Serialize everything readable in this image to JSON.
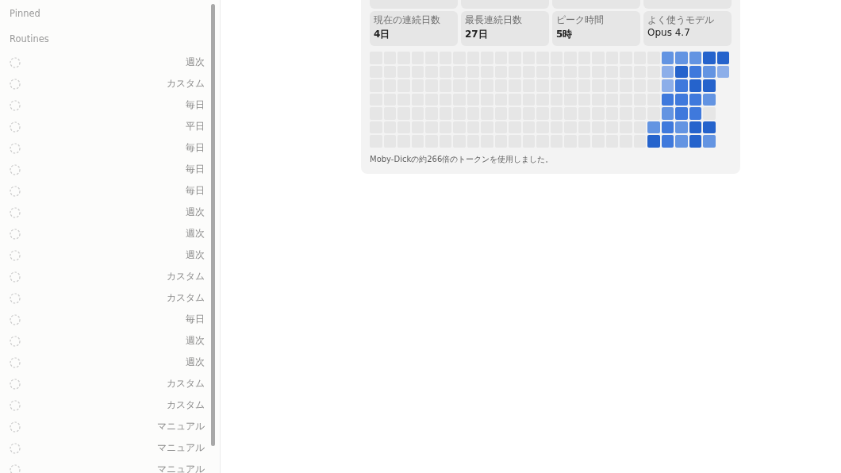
{
  "sidebar": {
    "sections": [
      {
        "title": "Pinned"
      },
      {
        "title": "Routines"
      }
    ],
    "routines": [
      {
        "schedule": "週次"
      },
      {
        "schedule": "カスタム"
      },
      {
        "schedule": "毎日"
      },
      {
        "schedule": "平日"
      },
      {
        "schedule": "毎日"
      },
      {
        "schedule": "毎日"
      },
      {
        "schedule": "毎日"
      },
      {
        "schedule": "週次"
      },
      {
        "schedule": "週次"
      },
      {
        "schedule": "週次"
      },
      {
        "schedule": "カスタム"
      },
      {
        "schedule": "カスタム"
      },
      {
        "schedule": "毎日"
      },
      {
        "schedule": "週次"
      },
      {
        "schedule": "週次"
      },
      {
        "schedule": "カスタム"
      },
      {
        "schedule": "カスタム"
      },
      {
        "schedule": "マニュアル"
      },
      {
        "schedule": "マニュアル"
      },
      {
        "schedule": "マニュアル"
      }
    ]
  },
  "stats": [
    {
      "label": "現在の連続日数",
      "value": "4日",
      "kind": "count"
    },
    {
      "label": "最長連続日数",
      "value": "27日",
      "kind": "count"
    },
    {
      "label": "ピーク時間",
      "value": "5時",
      "kind": "count"
    },
    {
      "label": "よく使うモデル",
      "value": "Opus 4.7",
      "kind": "name"
    }
  ],
  "activity": {
    "rows": [
      [
        {
          "color": "#e6e6e6"
        },
        {
          "color": "#e6e6e6"
        },
        {
          "color": "#e6e6e6"
        },
        {
          "color": "#e6e6e6"
        },
        {
          "color": "#e6e6e6"
        },
        {
          "color": "#e6e6e6"
        },
        {
          "color": "#e6e6e6"
        },
        {
          "color": "#e6e6e6"
        },
        {
          "color": "#e6e6e6"
        },
        {
          "color": "#e6e6e6"
        },
        {
          "color": "#e6e6e6"
        },
        {
          "color": "#e6e6e6"
        },
        {
          "color": "#e6e6e6"
        },
        {
          "color": "#e6e6e6"
        },
        {
          "color": "#e6e6e6"
        },
        {
          "color": "#e6e6e6"
        },
        {
          "color": "#e6e6e6"
        },
        {
          "color": "#e6e6e6"
        },
        {
          "color": "#e6e6e6"
        },
        {
          "color": "#e6e6e6"
        },
        {
          "color": "#e6e6e6"
        },
        {
          "color": "#6394e2"
        },
        {
          "color": "#6394e2"
        },
        {
          "color": "#6394e2"
        },
        {
          "color": "#2563cc"
        },
        {
          "color": "#2563cc"
        }
      ],
      [
        {
          "color": "#e6e6e6"
        },
        {
          "color": "#e6e6e6"
        },
        {
          "color": "#e6e6e6"
        },
        {
          "color": "#e6e6e6"
        },
        {
          "color": "#e6e6e6"
        },
        {
          "color": "#e6e6e6"
        },
        {
          "color": "#e6e6e6"
        },
        {
          "color": "#e6e6e6"
        },
        {
          "color": "#e6e6e6"
        },
        {
          "color": "#e6e6e6"
        },
        {
          "color": "#e6e6e6"
        },
        {
          "color": "#e6e6e6"
        },
        {
          "color": "#e6e6e6"
        },
        {
          "color": "#e6e6e6"
        },
        {
          "color": "#e6e6e6"
        },
        {
          "color": "#e6e6e6"
        },
        {
          "color": "#e6e6e6"
        },
        {
          "color": "#e6e6e6"
        },
        {
          "color": "#e6e6e6"
        },
        {
          "color": "#e6e6e6"
        },
        {
          "color": "#e6e6e6"
        },
        {
          "color": "#8caee9"
        },
        {
          "color": "#2563cc"
        },
        {
          "color": "#3f79dc"
        },
        {
          "color": "#6394e2"
        },
        {
          "color": "#8caee9"
        }
      ],
      [
        {
          "color": "#e6e6e6"
        },
        {
          "color": "#e6e6e6"
        },
        {
          "color": "#e6e6e6"
        },
        {
          "color": "#e6e6e6"
        },
        {
          "color": "#e6e6e6"
        },
        {
          "color": "#e6e6e6"
        },
        {
          "color": "#e6e6e6"
        },
        {
          "color": "#e6e6e6"
        },
        {
          "color": "#e6e6e6"
        },
        {
          "color": "#e6e6e6"
        },
        {
          "color": "#e6e6e6"
        },
        {
          "color": "#e6e6e6"
        },
        {
          "color": "#e6e6e6"
        },
        {
          "color": "#e6e6e6"
        },
        {
          "color": "#e6e6e6"
        },
        {
          "color": "#e6e6e6"
        },
        {
          "color": "#e6e6e6"
        },
        {
          "color": "#e6e6e6"
        },
        {
          "color": "#e6e6e6"
        },
        {
          "color": "#e6e6e6"
        },
        {
          "color": "#e6e6e6"
        },
        {
          "color": "#8caee9"
        },
        {
          "color": "#3f79dc"
        },
        {
          "color": "#2563cc"
        },
        {
          "color": "#2563cc"
        }
      ],
      [
        {
          "color": "#e6e6e6"
        },
        {
          "color": "#e6e6e6"
        },
        {
          "color": "#e6e6e6"
        },
        {
          "color": "#e6e6e6"
        },
        {
          "color": "#e6e6e6"
        },
        {
          "color": "#e6e6e6"
        },
        {
          "color": "#e6e6e6"
        },
        {
          "color": "#e6e6e6"
        },
        {
          "color": "#e6e6e6"
        },
        {
          "color": "#e6e6e6"
        },
        {
          "color": "#e6e6e6"
        },
        {
          "color": "#e6e6e6"
        },
        {
          "color": "#e6e6e6"
        },
        {
          "color": "#e6e6e6"
        },
        {
          "color": "#e6e6e6"
        },
        {
          "color": "#e6e6e6"
        },
        {
          "color": "#e6e6e6"
        },
        {
          "color": "#e6e6e6"
        },
        {
          "color": "#e6e6e6"
        },
        {
          "color": "#e6e6e6"
        },
        {
          "color": "#e6e6e6"
        },
        {
          "color": "#3f79dc"
        },
        {
          "color": "#3f79dc"
        },
        {
          "color": "#3f79dc"
        },
        {
          "color": "#6394e2"
        }
      ],
      [
        {
          "color": "#e6e6e6"
        },
        {
          "color": "#e6e6e6"
        },
        {
          "color": "#e6e6e6"
        },
        {
          "color": "#e6e6e6"
        },
        {
          "color": "#e6e6e6"
        },
        {
          "color": "#e6e6e6"
        },
        {
          "color": "#e6e6e6"
        },
        {
          "color": "#e6e6e6"
        },
        {
          "color": "#e6e6e6"
        },
        {
          "color": "#e6e6e6"
        },
        {
          "color": "#e6e6e6"
        },
        {
          "color": "#e6e6e6"
        },
        {
          "color": "#e6e6e6"
        },
        {
          "color": "#e6e6e6"
        },
        {
          "color": "#e6e6e6"
        },
        {
          "color": "#e6e6e6"
        },
        {
          "color": "#e6e6e6"
        },
        {
          "color": "#e6e6e6"
        },
        {
          "color": "#e6e6e6"
        },
        {
          "color": "#e6e6e6"
        },
        {
          "color": "#e6e6e6"
        },
        {
          "color": "#6394e2"
        },
        {
          "color": "#3f79dc"
        },
        {
          "color": "#3f79dc"
        },
        {
          "color": "#e6e6e6"
        }
      ],
      [
        {
          "color": "#e6e6e6"
        },
        {
          "color": "#e6e6e6"
        },
        {
          "color": "#e6e6e6"
        },
        {
          "color": "#e6e6e6"
        },
        {
          "color": "#e6e6e6"
        },
        {
          "color": "#e6e6e6"
        },
        {
          "color": "#e6e6e6"
        },
        {
          "color": "#e6e6e6"
        },
        {
          "color": "#e6e6e6"
        },
        {
          "color": "#e6e6e6"
        },
        {
          "color": "#e6e6e6"
        },
        {
          "color": "#e6e6e6"
        },
        {
          "color": "#e6e6e6"
        },
        {
          "color": "#e6e6e6"
        },
        {
          "color": "#e6e6e6"
        },
        {
          "color": "#e6e6e6"
        },
        {
          "color": "#e6e6e6"
        },
        {
          "color": "#e6e6e6"
        },
        {
          "color": "#e6e6e6"
        },
        {
          "color": "#e6e6e6"
        },
        {
          "color": "#6394e2"
        },
        {
          "color": "#3f79dc"
        },
        {
          "color": "#6394e2"
        },
        {
          "color": "#2563cc"
        },
        {
          "color": "#2563cc"
        }
      ],
      [
        {
          "color": "#e6e6e6"
        },
        {
          "color": "#e6e6e6"
        },
        {
          "color": "#e6e6e6"
        },
        {
          "color": "#e6e6e6"
        },
        {
          "color": "#e6e6e6"
        },
        {
          "color": "#e6e6e6"
        },
        {
          "color": "#e6e6e6"
        },
        {
          "color": "#e6e6e6"
        },
        {
          "color": "#e6e6e6"
        },
        {
          "color": "#e6e6e6"
        },
        {
          "color": "#e6e6e6"
        },
        {
          "color": "#e6e6e6"
        },
        {
          "color": "#e6e6e6"
        },
        {
          "color": "#e6e6e6"
        },
        {
          "color": "#e6e6e6"
        },
        {
          "color": "#e6e6e6"
        },
        {
          "color": "#e6e6e6"
        },
        {
          "color": "#e6e6e6"
        },
        {
          "color": "#e6e6e6"
        },
        {
          "color": "#e6e6e6"
        },
        {
          "color": "#2563cc"
        },
        {
          "color": "#3f79dc"
        },
        {
          "color": "#6394e2"
        },
        {
          "color": "#2563cc"
        },
        {
          "color": "#6394e2"
        }
      ]
    ],
    "note": "Moby-Dickの約266倍のトークンを使用しました。"
  }
}
